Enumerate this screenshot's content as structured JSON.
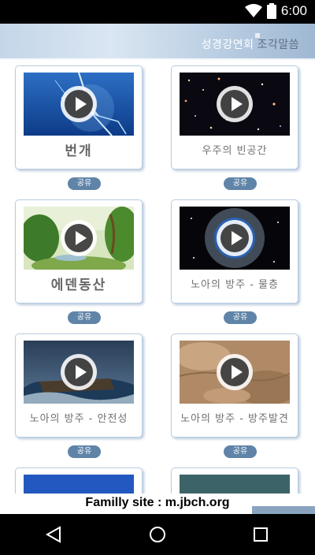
{
  "status_bar": {
    "time": "6:00",
    "icons": [
      "wifi-icon",
      "battery-icon"
    ]
  },
  "header": {
    "title_part1": "성경강연회",
    "title_part2": "조각말씀"
  },
  "cards": [
    {
      "title": "번개",
      "share": "공유",
      "thumb": "lightning"
    },
    {
      "title": "우주의 빈공간",
      "share": "공유",
      "thumb": "space"
    },
    {
      "title": "에덴동산",
      "share": "공유",
      "thumb": "eden"
    },
    {
      "title": "노아의 방주 - 물층",
      "share": "공유",
      "thumb": "earth-bubble"
    },
    {
      "title": "노아의 방주 - 안전성",
      "share": "공유",
      "thumb": "storm-ark"
    },
    {
      "title": "노아의 방주 - 방주발견",
      "share": "공유",
      "thumb": "desert"
    }
  ],
  "footer": {
    "text": "Familly site : m.jbch.org"
  },
  "nav_bar": {
    "buttons": [
      "back-icon",
      "home-icon",
      "recents-icon"
    ]
  }
}
